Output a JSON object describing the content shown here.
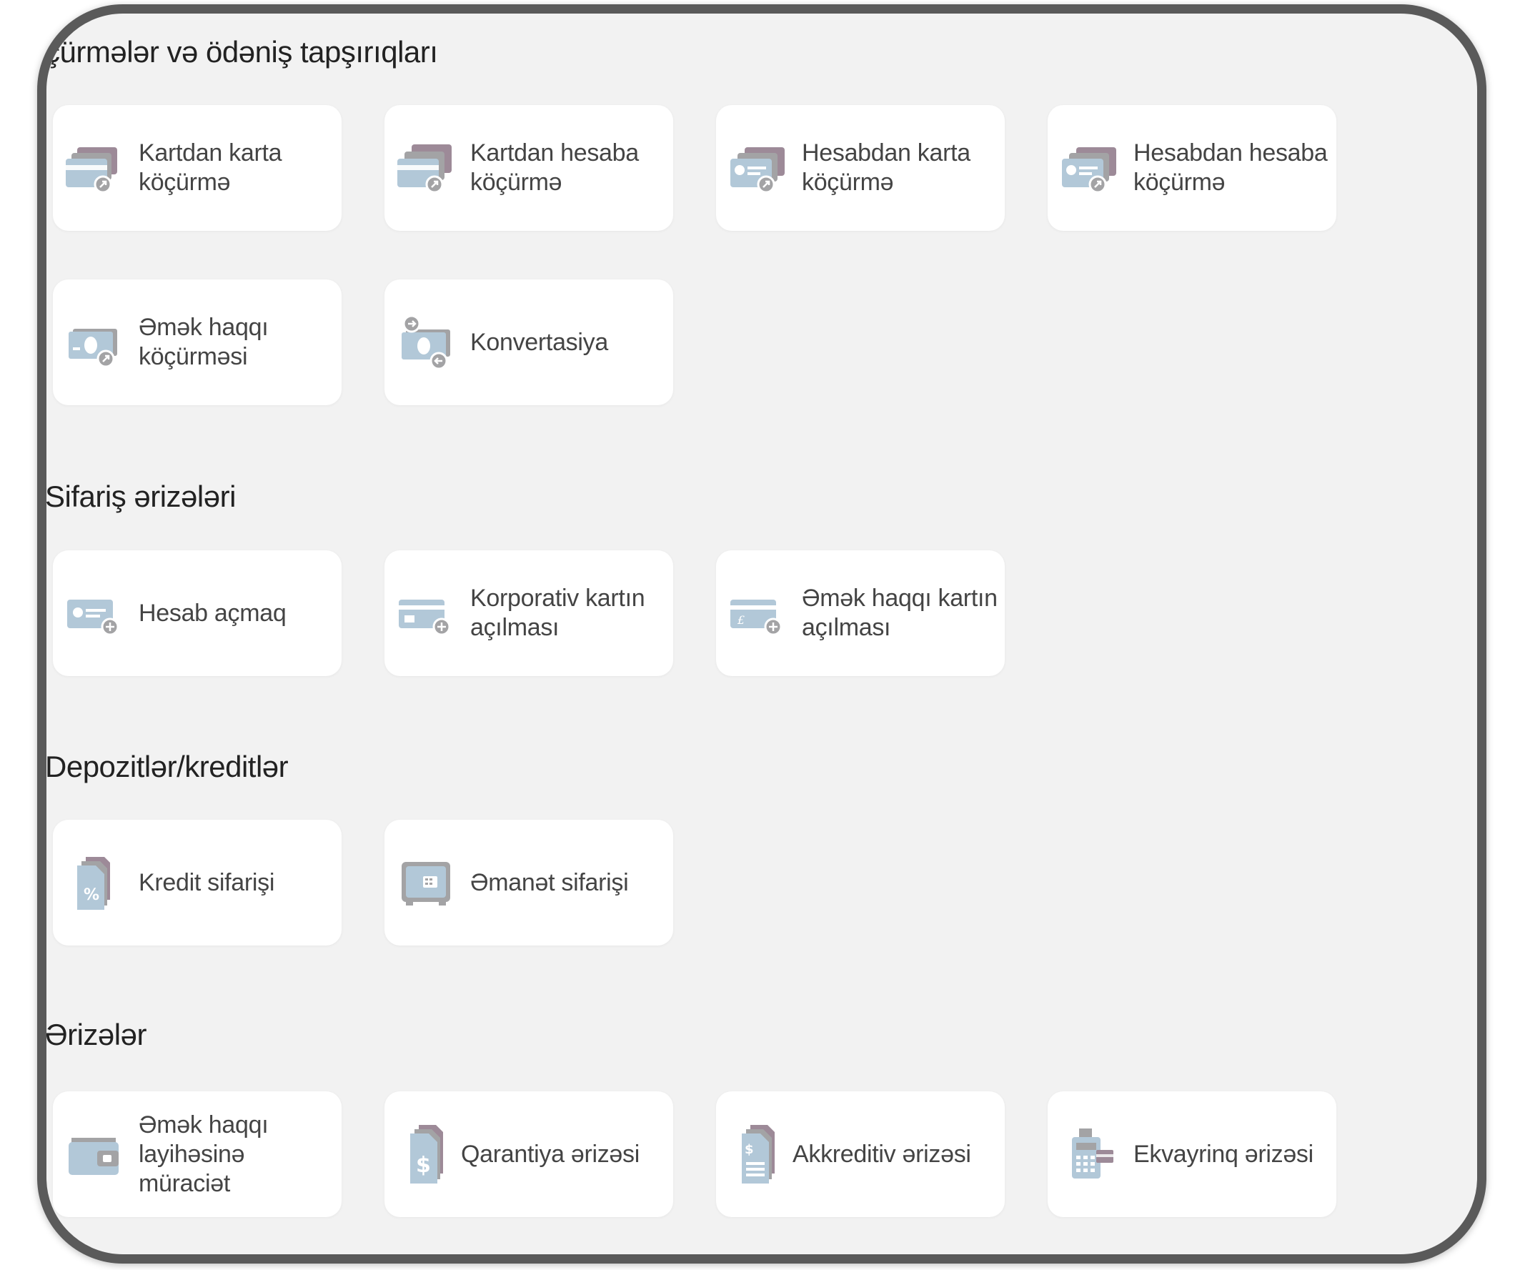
{
  "colors": {
    "frame": "#5a5a5a",
    "background": "#f2f2f2",
    "card": "#ffffff",
    "icon_blue": "#b2c8d8",
    "icon_gray": "#a3a3a5",
    "icon_mauve": "#9d8a98"
  },
  "sections": {
    "transfers": {
      "title": "çürmələr və ödəniş tapşırıqları",
      "items": [
        {
          "label": "Kartdan karta\nköçürmə",
          "icon": "card-to-card-icon"
        },
        {
          "label": "Kartdan hesaba\nköçürmə",
          "icon": "card-to-account-icon"
        },
        {
          "label": "Hesabdan karta\nköçürmə",
          "icon": "account-to-card-icon"
        },
        {
          "label": "Hesabdan hesaba\nköçürmə",
          "icon": "account-to-account-icon"
        },
        {
          "label": "Əmək haqqı\nköçürməsi",
          "icon": "salary-transfer-icon"
        },
        {
          "label": "Konvertasiya",
          "icon": "currency-exchange-icon"
        }
      ]
    },
    "orders": {
      "title": "Sifariş ərizələri",
      "items": [
        {
          "label": "Hesab açmaq",
          "icon": "open-account-icon"
        },
        {
          "label": "Korporativ kartın\naçılması",
          "icon": "corporate-card-icon"
        },
        {
          "label": "Əmək haqqı kartın\naçılması",
          "icon": "salary-card-icon"
        }
      ]
    },
    "deposits": {
      "title": "Depozitlər/kreditlər",
      "items": [
        {
          "label": "Kredit sifarişi",
          "icon": "credit-percent-icon"
        },
        {
          "label": "Əmanət sifarişi",
          "icon": "safe-icon"
        }
      ]
    },
    "applications": {
      "title": "Ərizələr",
      "items": [
        {
          "label": "Əmək haqqı\nlayihəsinə müraciət",
          "icon": "wallet-icon"
        },
        {
          "label": "Qarantiya ərizəsi",
          "icon": "guarantee-document-icon"
        },
        {
          "label": "Akkreditiv ərizəsi",
          "icon": "letter-of-credit-icon"
        },
        {
          "label": "Ekvayrinq ərizəsi",
          "icon": "pos-terminal-icon"
        }
      ]
    }
  }
}
